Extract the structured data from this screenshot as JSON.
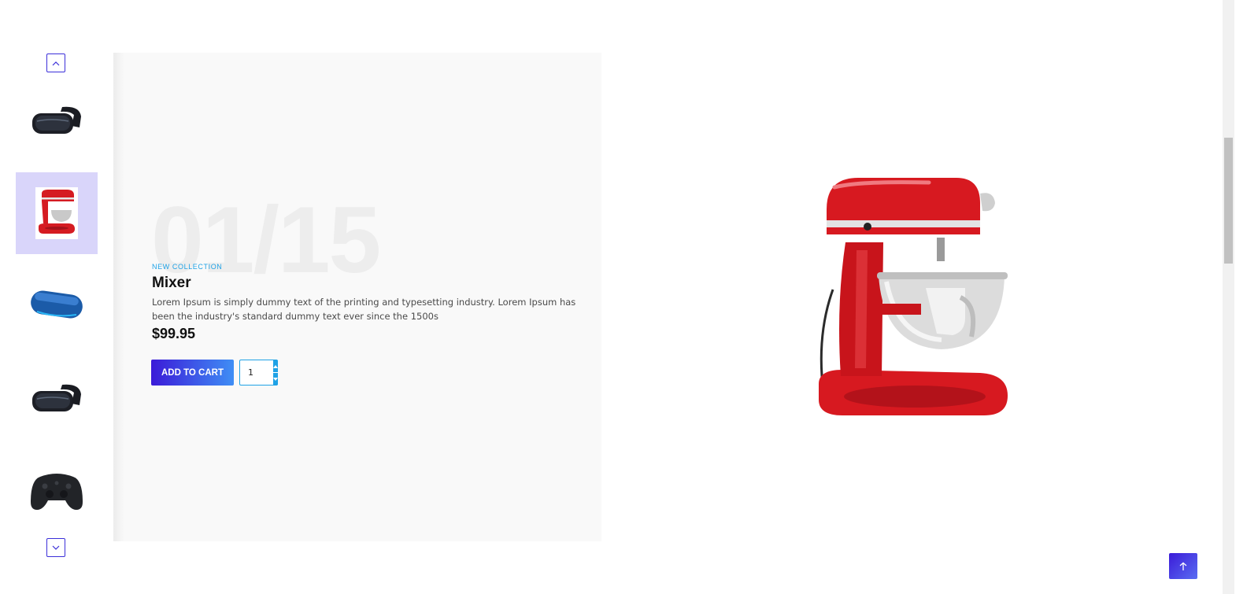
{
  "slider": {
    "thumbnails": [
      {
        "product": "vr-headset",
        "active": false
      },
      {
        "product": "mixer",
        "active": true
      },
      {
        "product": "bluetooth-speaker",
        "active": false
      },
      {
        "product": "vr-headset",
        "active": false
      },
      {
        "product": "game-controller",
        "active": false
      }
    ],
    "icons": {
      "up": "chevron-up-icon",
      "down": "chevron-down-icon"
    }
  },
  "product": {
    "counter": "01/15",
    "eyebrow": "NEW COLLECTION",
    "title": "Mixer",
    "description": "Lorem Ipsum is simply dummy text of the printing and typesetting industry. Lorem Ipsum has been the industry's standard dummy text ever since the 1500s",
    "price": "$99.95",
    "add_to_cart_label": "ADD TO CART",
    "quantity": "1"
  },
  "back_to_top": {
    "icon": "arrow-up-icon"
  },
  "colors": {
    "accent": "#3b1bd8",
    "accent_light": "#1fa2e6",
    "active_thumb_bg": "#d9d5fa",
    "panel_bg": "#f9f9f9"
  }
}
